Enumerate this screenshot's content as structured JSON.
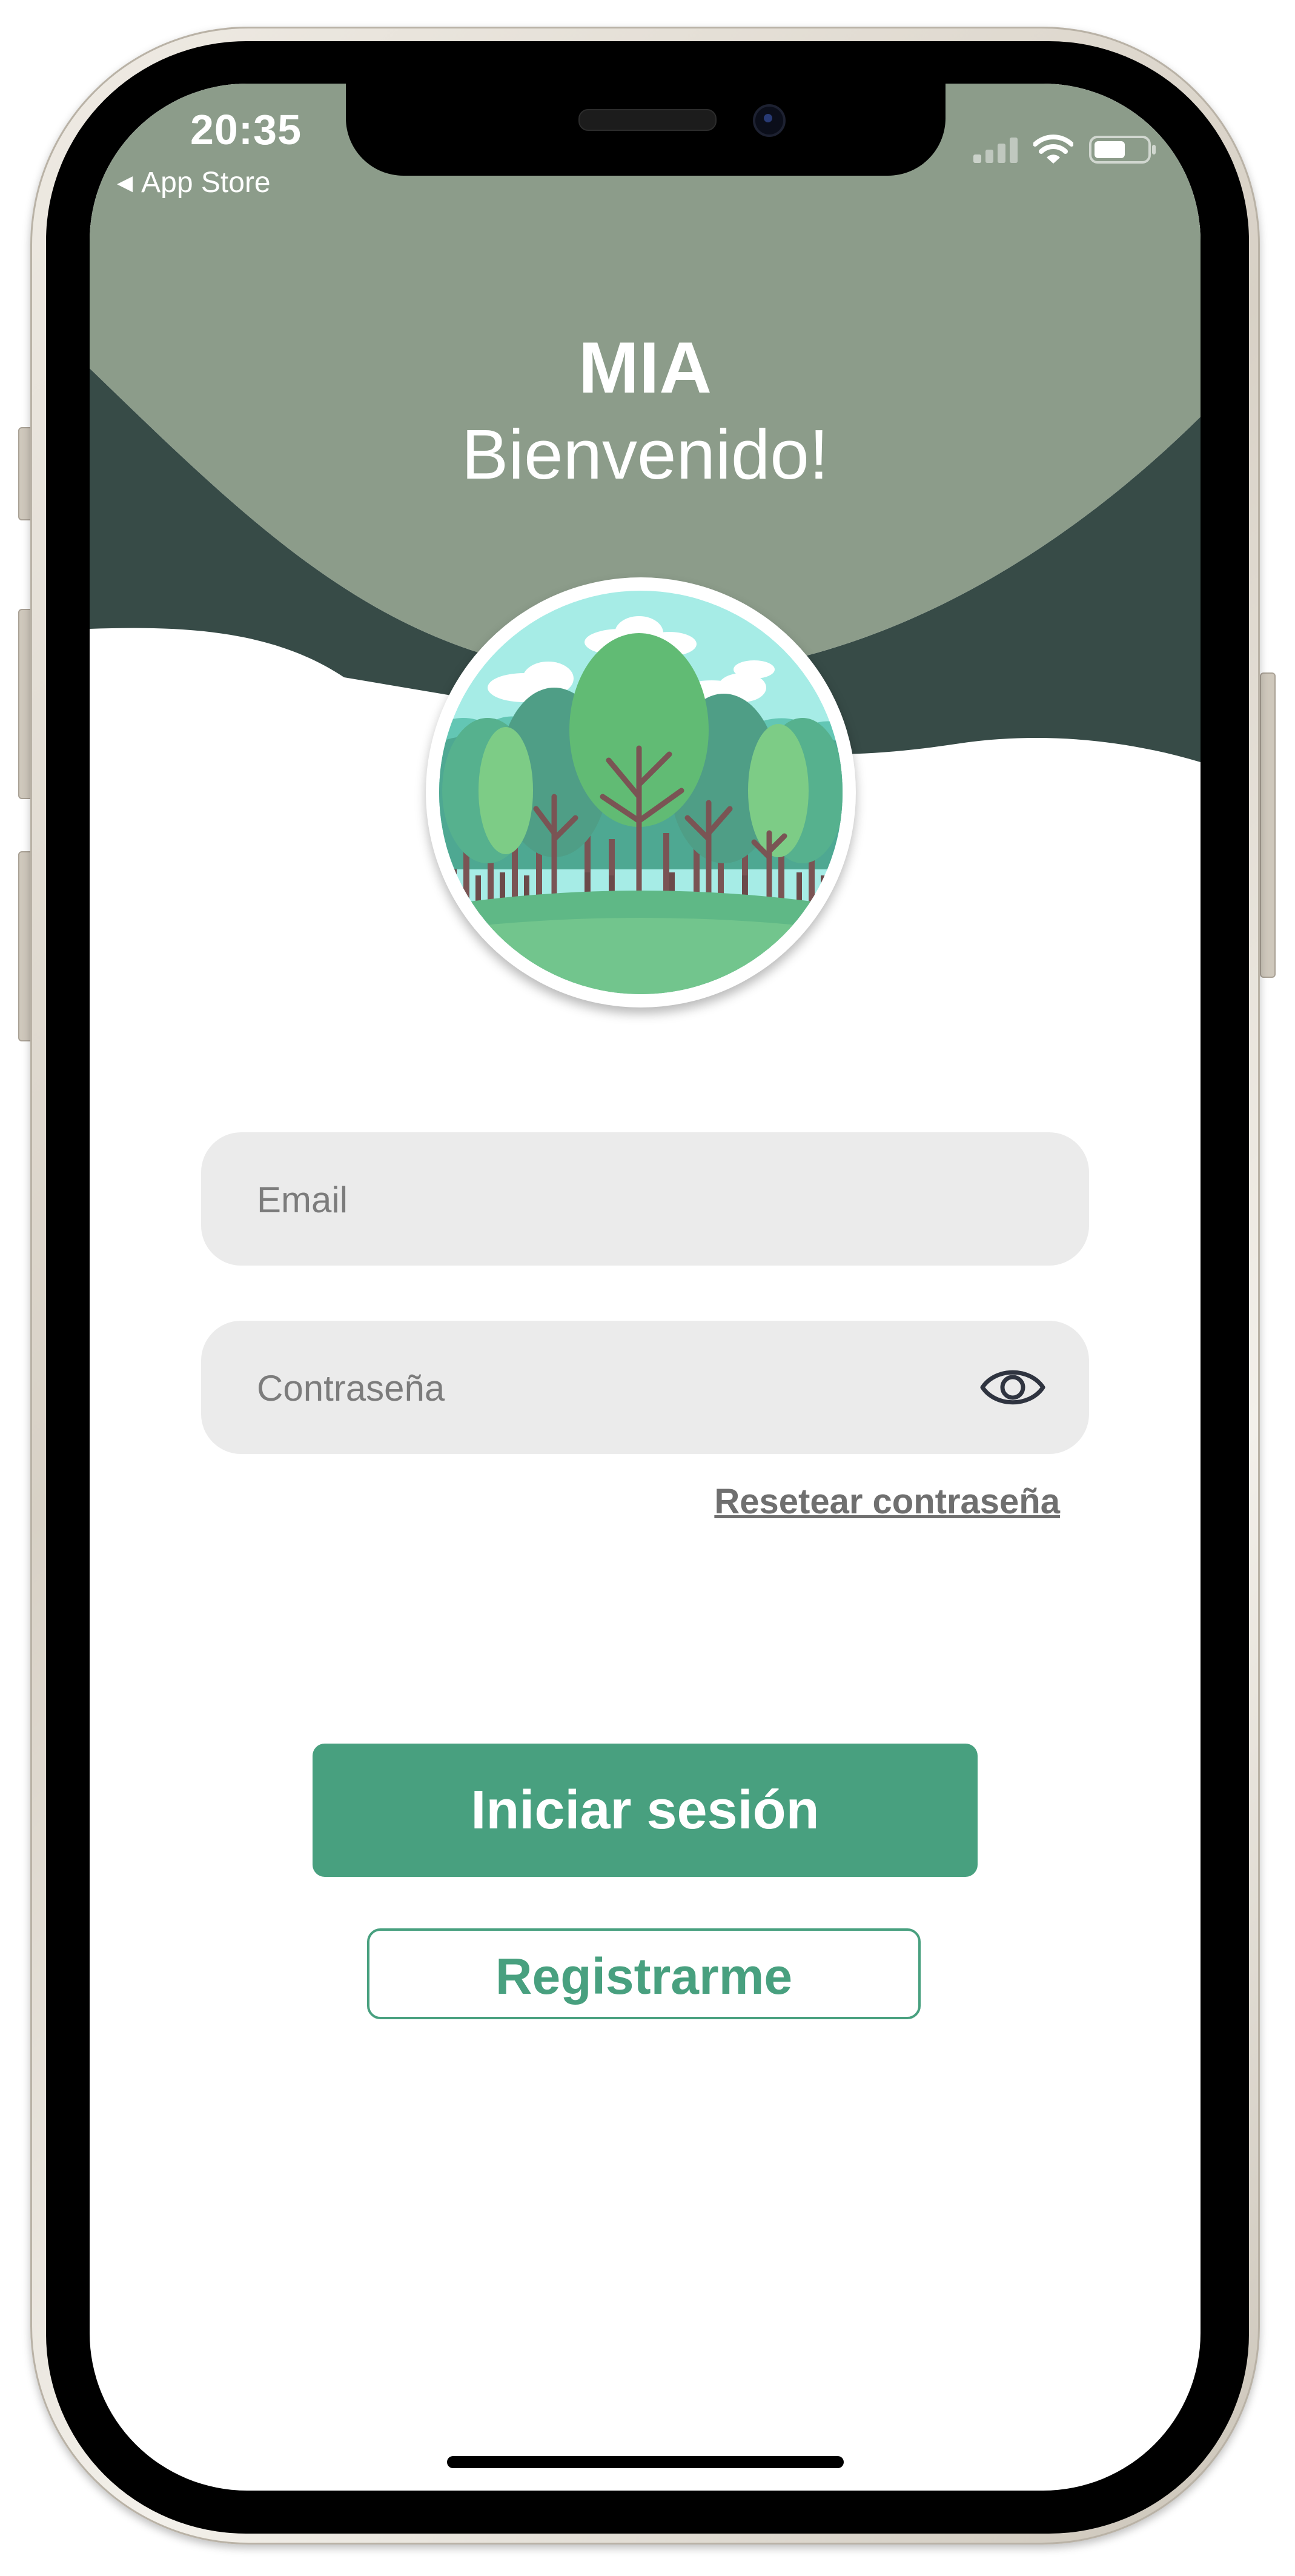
{
  "colors": {
    "header_bg": "#8c9c8a",
    "dark_wave": "#374b47",
    "brand_green": "#48a07f",
    "field_bg": "#ebebeb",
    "placeholder": "#7c7c7c",
    "link": "#6f6f6f"
  },
  "status_bar": {
    "time": "20:35",
    "back_label": "App Store",
    "back_icon": "back-triangle-icon",
    "icons": [
      "cellular-signal-icon",
      "wifi-icon",
      "battery-icon"
    ]
  },
  "header": {
    "app_name": "MIA",
    "welcome": "Bienvenido!"
  },
  "logo": {
    "icon": "forest-logo-icon"
  },
  "form": {
    "email_placeholder": "Email",
    "email_value": "",
    "password_placeholder": "Contraseña",
    "password_value": "",
    "password_toggle_icon": "eye-icon",
    "reset_link": "Resetear contraseña"
  },
  "actions": {
    "login_label": "Iniciar sesión",
    "register_label": "Registrarme"
  }
}
